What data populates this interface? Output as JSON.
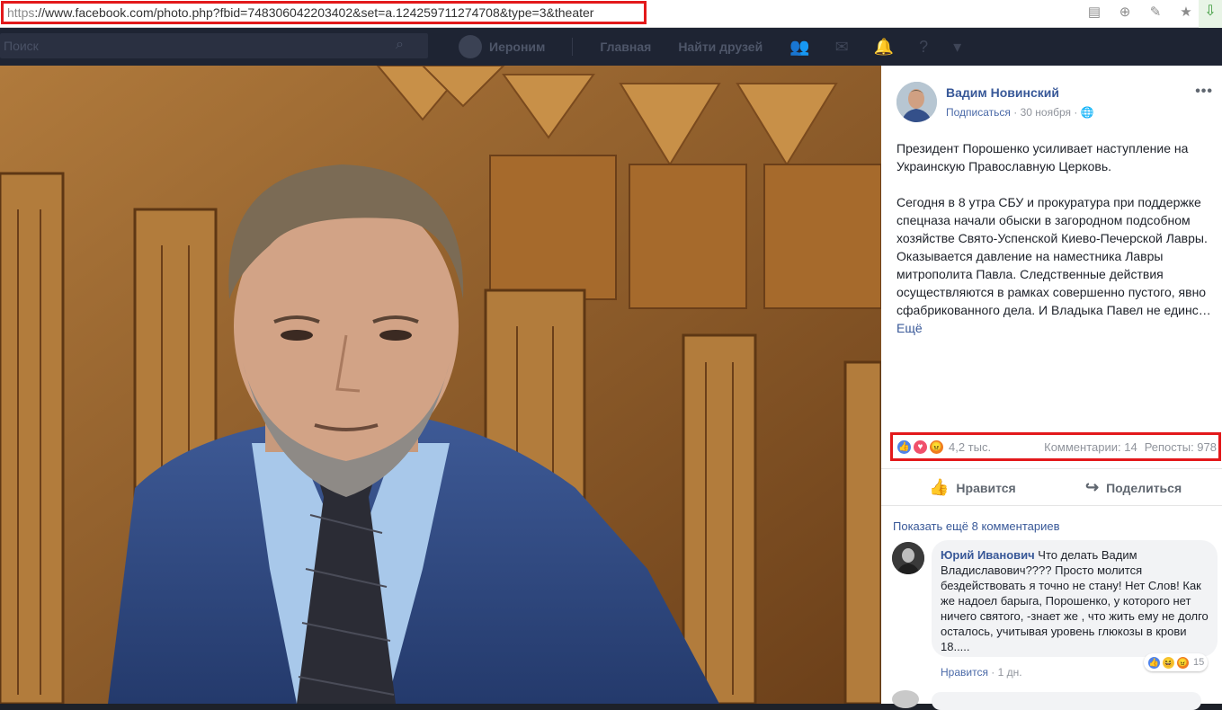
{
  "browser": {
    "url_protocol": "https",
    "url_rest": "://www.facebook.com/photo.php?fbid=748306042203402&set=a.124259711274708&type=3&theater",
    "icons": [
      "reader-icon",
      "search-zoom-icon",
      "pin-icon",
      "star-icon",
      "download-icon"
    ]
  },
  "fb_header": {
    "search_placeholder": "Поиск",
    "user_name": "Иероним",
    "home_label": "Главная",
    "find_friends_label": "Найти друзей"
  },
  "post": {
    "author": "Вадим Новинский",
    "subscribe_label": "Подписаться",
    "date": "30 ноября",
    "paragraph1": "Президент Порошенко усиливает наступление на Украинскую Православную Церковь.",
    "paragraph2": "Сегодня в 8 утра СБУ и прокуратура при поддержке спецназа начали обыски в загородном подсобном хозяйстве Свято-Успенской Киево-Печерской Лавры. Оказывается давление на наместника Лавры митрополита Павла. Следственные действия осуществляются в рамках совершенно пустого, явно сфабрикованного дела. И Владыка Павел не единс…",
    "more_label": "Ещё"
  },
  "stats": {
    "reactions_count": "4,2 тыс.",
    "comments": "Комментарии: 14",
    "shares": "Репосты: 978"
  },
  "actions": {
    "like_label": "Нравится",
    "share_label": "Поделиться"
  },
  "comments": {
    "show_more": "Показать ещё 8 комментариев",
    "items": [
      {
        "author": "Юрий Иванович",
        "text": "Что делать Вадим Владиславович???? Просто молится бездействовать я точно не стану! Нет Слов! Как же надоел барыга, Порошенко, у которого нет ничего святого, -знает же , что жить ему не долго осталось, учитывая уровень глюкозы в крови 18.....",
        "reaction_count": "15",
        "like_label": "Нравится",
        "time": "1 дн."
      }
    ]
  },
  "colors": {
    "highlight_box": "#e3191b",
    "fb_link": "#385898",
    "fb_header_bg": "#1e2433"
  }
}
